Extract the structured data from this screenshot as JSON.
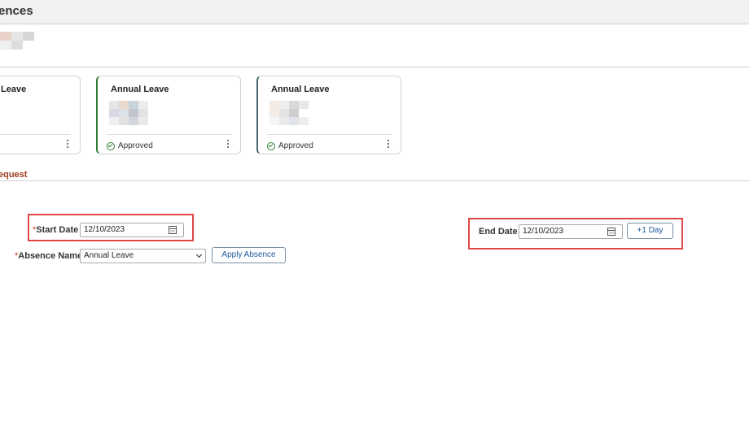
{
  "header": {
    "title": "ences"
  },
  "cards": [
    {
      "title": "Leave",
      "status": ""
    },
    {
      "title": "Annual Leave",
      "status": "Approved",
      "accent": "#2e7d32"
    },
    {
      "title": "Annual Leave",
      "status": "Approved",
      "accent": "#4a6670"
    }
  ],
  "section": {
    "title": "equest"
  },
  "form": {
    "start_date": {
      "required_mark": "*",
      "label": "Start Date",
      "value": "12/10/2023"
    },
    "end_date": {
      "label": "End Date",
      "value": "12/10/2023"
    },
    "plus_day_label": "+1 Day",
    "absence_name": {
      "required_mark": "*",
      "label": "Absence Name",
      "value": "Annual Leave"
    },
    "apply_label": "Apply Absence"
  },
  "colors": {
    "section_title": "#9b3a1a",
    "highlight": "#e04848",
    "link_blue": "#1e5aa0"
  }
}
